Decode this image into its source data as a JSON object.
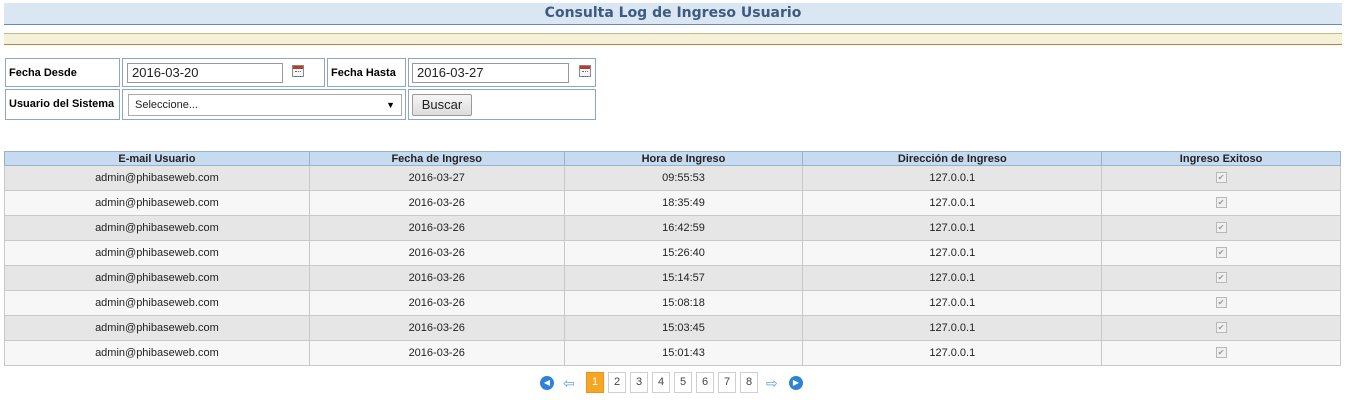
{
  "page": {
    "title": "Consulta Log de Ingreso Usuario"
  },
  "filters": {
    "fecha_desde_label": "Fecha Desde",
    "fecha_desde_value": "2016-03-20",
    "fecha_hasta_label": "Fecha Hasta",
    "fecha_hasta_value": "2016-03-27",
    "usuario_label": "Usuario del Sistema",
    "usuario_selected": "Seleccione...",
    "buscar_label": "Buscar"
  },
  "table": {
    "columns": [
      "E-mail Usuario",
      "Fecha de Ingreso",
      "Hora de Ingreso",
      "Dirección de Ingreso",
      "Ingreso Exitoso"
    ],
    "rows": [
      {
        "email": "admin@phibaseweb.com",
        "fecha": "2016-03-27",
        "hora": "09:55:53",
        "ip": "127.0.0.1",
        "exitoso": true
      },
      {
        "email": "admin@phibaseweb.com",
        "fecha": "2016-03-26",
        "hora": "18:35:49",
        "ip": "127.0.0.1",
        "exitoso": true
      },
      {
        "email": "admin@phibaseweb.com",
        "fecha": "2016-03-26",
        "hora": "16:42:59",
        "ip": "127.0.0.1",
        "exitoso": true
      },
      {
        "email": "admin@phibaseweb.com",
        "fecha": "2016-03-26",
        "hora": "15:26:40",
        "ip": "127.0.0.1",
        "exitoso": true
      },
      {
        "email": "admin@phibaseweb.com",
        "fecha": "2016-03-26",
        "hora": "15:14:57",
        "ip": "127.0.0.1",
        "exitoso": true
      },
      {
        "email": "admin@phibaseweb.com",
        "fecha": "2016-03-26",
        "hora": "15:08:18",
        "ip": "127.0.0.1",
        "exitoso": true
      },
      {
        "email": "admin@phibaseweb.com",
        "fecha": "2016-03-26",
        "hora": "15:03:45",
        "ip": "127.0.0.1",
        "exitoso": true
      },
      {
        "email": "admin@phibaseweb.com",
        "fecha": "2016-03-26",
        "hora": "15:01:43",
        "ip": "127.0.0.1",
        "exitoso": true
      }
    ]
  },
  "pager": {
    "pages": [
      "1",
      "2",
      "3",
      "4",
      "5",
      "6",
      "7",
      "8"
    ],
    "current": "1",
    "icons": [
      "first-page-icon",
      "prev-page-icon",
      "next-page-icon",
      "last-page-icon"
    ]
  },
  "colors": {
    "header_bg": "#c6dbef",
    "title_color": "#3d5a80",
    "active_page": "#f5a623"
  }
}
